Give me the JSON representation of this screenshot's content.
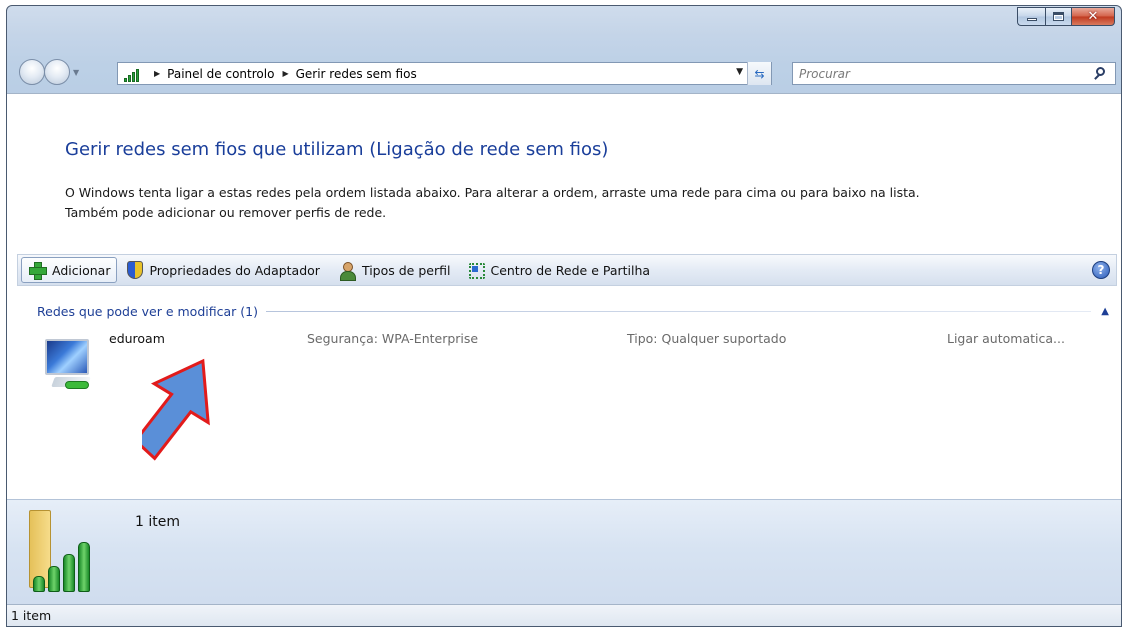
{
  "address": {
    "crumbs": [
      "Painel de controlo",
      "Gerir redes sem fios"
    ]
  },
  "search": {
    "placeholder": "Procurar"
  },
  "main": {
    "title": "Gerir redes sem fios que utilizam (Ligação de rede sem fios)",
    "description_line1": "O Windows tenta ligar a estas redes pela ordem listada abaixo. Para alterar a ordem, arraste uma rede para cima ou para baixo na lista.",
    "description_line2": "Também pode adicionar ou remover perfis de rede."
  },
  "toolbar": {
    "add_label": "Adicionar",
    "adapter_label": "Propriedades do Adaptador",
    "profile_types_label": "Tipos de perfil",
    "network_center_label": "Centro de Rede e Partilha",
    "help_glyph": "?"
  },
  "group": {
    "label": "Redes que pode ver e modificar (1)"
  },
  "networks": [
    {
      "name": "eduroam",
      "security": "Segurança:  WPA-Enterprise",
      "type": "Tipo:  Qualquer suportado",
      "mode": "Ligar automatica..."
    }
  ],
  "details": {
    "count": "1 item"
  },
  "statusbar": {
    "text": "1 item"
  },
  "colors": {
    "title_blue": "#1a3e9a",
    "arrow_fill": "#5a8fd8",
    "arrow_outline": "#e21b1b"
  },
  "icons": {
    "close": "close-icon",
    "search": "search-icon",
    "help": "help-icon"
  }
}
